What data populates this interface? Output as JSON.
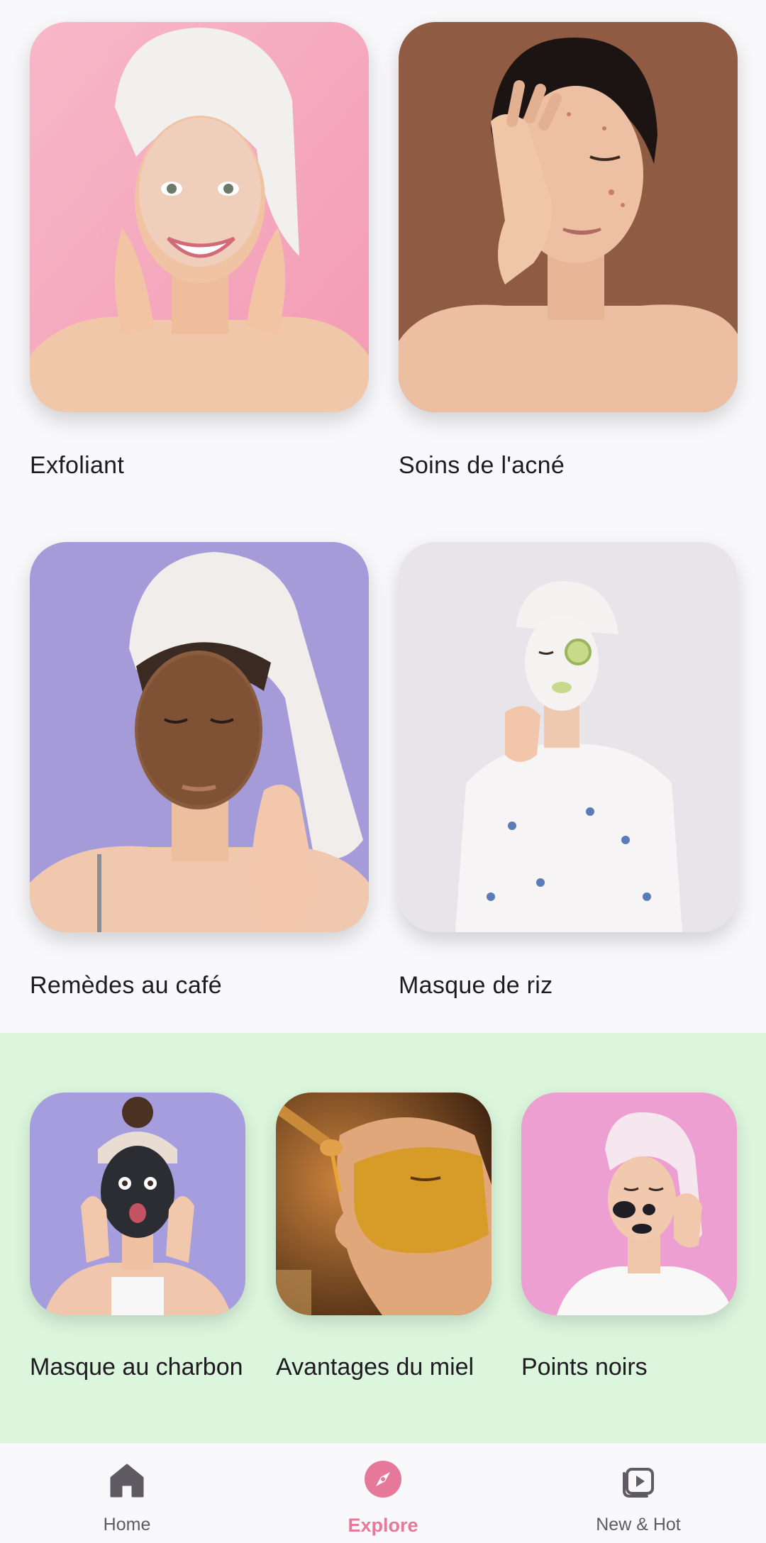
{
  "grid_top": [
    {
      "label": "Exfoliant",
      "image": "exfoliant-photo"
    },
    {
      "label": "Soins de l'acné",
      "image": "acne-care-photo"
    },
    {
      "label": "Remèdes au café",
      "image": "coffee-remedies-photo"
    },
    {
      "label": "Masque de riz",
      "image": "rice-mask-photo"
    }
  ],
  "band": {
    "background": "#dcf6dd",
    "items": [
      {
        "label": "Masque au charbon",
        "image": "charcoal-mask-photo"
      },
      {
        "label": "Avantages du miel",
        "image": "honey-benefits-photo"
      },
      {
        "label": "Points noirs",
        "image": "blackheads-photo"
      }
    ]
  },
  "nav": {
    "active_color": "#e6799a",
    "items": [
      {
        "label": "Home",
        "icon": "home-icon",
        "active": false
      },
      {
        "label": "Explore",
        "icon": "compass-icon",
        "active": true
      },
      {
        "label": "New & Hot",
        "icon": "play-library-icon",
        "active": false
      }
    ]
  }
}
